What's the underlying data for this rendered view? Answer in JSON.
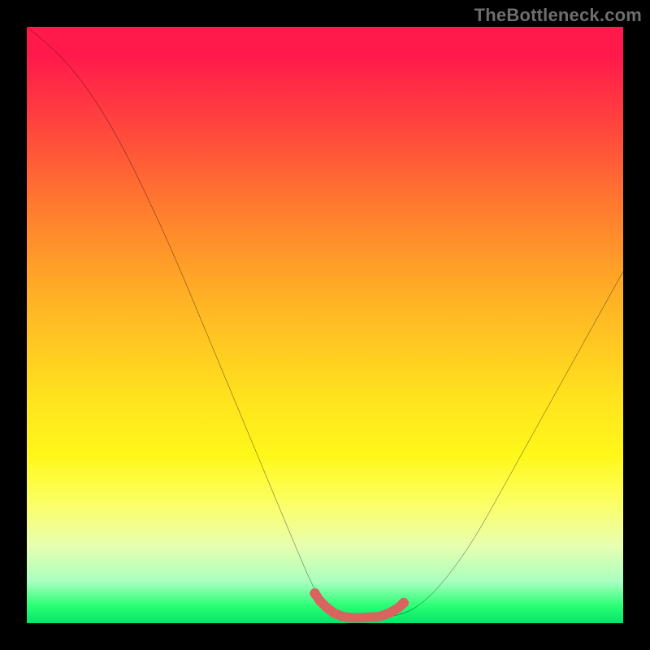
{
  "watermark": "TheBottleneck.com",
  "chart_data": {
    "type": "line",
    "title": "",
    "xlabel": "",
    "ylabel": "",
    "xlim": [
      0,
      100
    ],
    "ylim": [
      0,
      100
    ],
    "grid": false,
    "series": [
      {
        "name": "curve",
        "color": "#000000",
        "x": [
          0,
          5,
          10,
          15,
          20,
          25,
          30,
          35,
          40,
          45,
          48,
          50,
          52,
          55,
          58,
          60,
          63,
          66,
          70,
          75,
          80,
          85,
          90,
          95,
          100
        ],
        "values": [
          100,
          96,
          90,
          82,
          72,
          61,
          49,
          37,
          25,
          13,
          6,
          3,
          1.5,
          0.8,
          0.8,
          1.0,
          1.5,
          3,
          7,
          14,
          23,
          32,
          41,
          50,
          59
        ]
      },
      {
        "name": "highlight",
        "color": "#d9635f",
        "x": [
          48.3,
          49.1,
          50.2,
          51.5,
          53.0,
          54.5,
          56.0,
          57.5,
          59.0,
          60.0,
          61.0,
          62.3,
          63.2
        ],
        "values": [
          5.0,
          3.8,
          2.7,
          1.7,
          1.1,
          0.9,
          0.9,
          1.0,
          1.1,
          1.4,
          1.8,
          2.6,
          3.4
        ]
      }
    ],
    "gradient_stops": [
      {
        "pos": 0,
        "color": "#ff1a4b"
      },
      {
        "pos": 5,
        "color": "#ff1a4b"
      },
      {
        "pos": 15,
        "color": "#ff3f3f"
      },
      {
        "pos": 30,
        "color": "#ff7a2e"
      },
      {
        "pos": 45,
        "color": "#ffb025"
      },
      {
        "pos": 62,
        "color": "#ffe21e"
      },
      {
        "pos": 72,
        "color": "#fff81a"
      },
      {
        "pos": 80,
        "color": "#fbff66"
      },
      {
        "pos": 87,
        "color": "#e7ffb0"
      },
      {
        "pos": 93,
        "color": "#aaffc0"
      },
      {
        "pos": 97,
        "color": "#2cff75"
      },
      {
        "pos": 100,
        "color": "#00e66a"
      }
    ]
  }
}
